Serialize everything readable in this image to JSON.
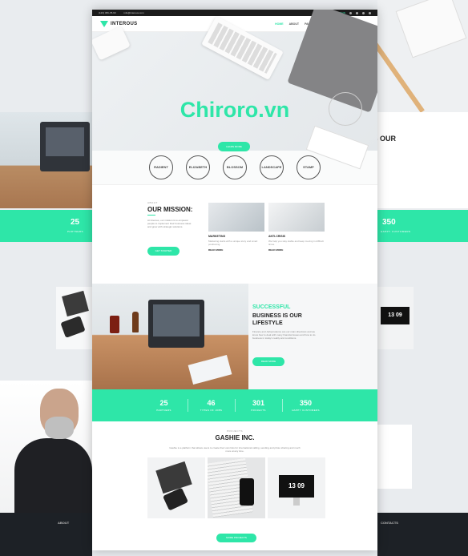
{
  "watermark": "Chiroro.vn",
  "topbar": {
    "phone": "(123) 456-78-90",
    "email": "info@interous.com",
    "login": "LOGIN"
  },
  "logo": "INTEROUS",
  "nav": [
    "HOME",
    "ABOUT",
    "PAGES",
    "FEATURES",
    "BLOG",
    "CONTACTS"
  ],
  "hero": {
    "button": "LEARN MORE"
  },
  "badges": [
    "RADIENT",
    "ELIZABETH",
    "BLOSSOM",
    "LANDSCAPE",
    "STAMP"
  ],
  "mission": {
    "eyebrow": "ABOUT",
    "heading": "OUR MISSION:",
    "text": "At Interous, our mission is to empower people to implement their business ideas and grow with strategic solutions.",
    "button": "GET STARTED",
    "cards": [
      {
        "title": "MARKETING",
        "text": "Marketing starts with a unique story and smart positioning.",
        "more": "READ MORE"
      },
      {
        "title": "ANTI-CRISIS",
        "text": "We help you stay stable and keep moving in difficult times.",
        "more": "READ MORE"
      }
    ]
  },
  "success": {
    "line1": "SUCCESSFUL",
    "line2": "BUSINESS IS OUR LIFESTYLE",
    "text": "Finance and Jurisprudence are our main directions and we know how to deal with many financial issues and how to do business in today's reality and conditions.",
    "button": "READ MORE"
  },
  "stats": [
    {
      "value": "25",
      "label": "PARTNERS"
    },
    {
      "value": "46",
      "label": "TYPES OF JOBS"
    },
    {
      "value": "301",
      "label": "PROJECTS"
    },
    {
      "value": "350",
      "label": "HAPPY CUSTOMERS"
    }
  ],
  "bg_left_stat": {
    "value": "25",
    "label": "PARTNERS"
  },
  "bg_right_stat": {
    "value": "350",
    "label": "HAPPY CUSTOMERS"
  },
  "bg_right_heading": "S OUR",
  "bg_clock": "13 09",
  "footer_about": "ABOUT",
  "footer_contacts": "CONTACTS",
  "projects": {
    "eyebrow": "PROJECTS",
    "heading": "GASHIE INC.",
    "text": "Gashie is a platform that allows users to create their own lists for international calling, sending and photo sharing and much more at any time.",
    "clock": "13 09",
    "button": "MORE PROJECTS"
  }
}
